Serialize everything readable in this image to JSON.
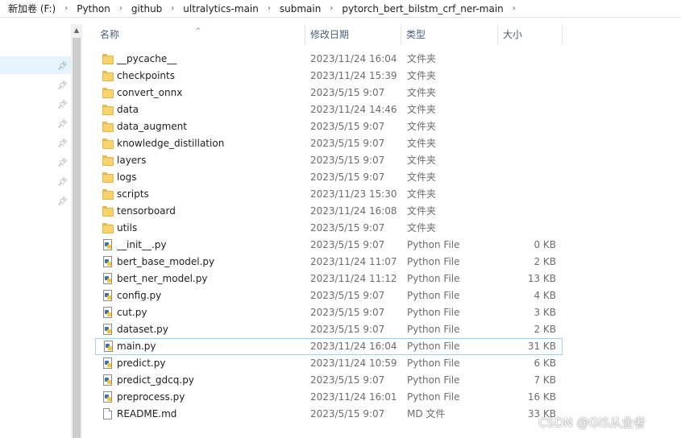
{
  "breadcrumb": [
    "新加卷 (F:)",
    "Python",
    "github",
    "ultralytics-main",
    "submain",
    "pytorch_bert_bilstm_crf_ner-main"
  ],
  "breadcrumb_separator": "›",
  "columns": {
    "name": "名称",
    "date": "修改日期",
    "type": "类型",
    "size": "大小",
    "sort_indicator": "^"
  },
  "files": [
    {
      "name": "__pycache__",
      "date": "2023/11/24 16:04",
      "type": "文件夹",
      "size": "",
      "icon": "folder-icon"
    },
    {
      "name": "checkpoints",
      "date": "2023/11/24 15:39",
      "type": "文件夹",
      "size": "",
      "icon": "folder-icon"
    },
    {
      "name": "convert_onnx",
      "date": "2023/5/15 9:07",
      "type": "文件夹",
      "size": "",
      "icon": "folder-icon"
    },
    {
      "name": "data",
      "date": "2023/11/24 14:46",
      "type": "文件夹",
      "size": "",
      "icon": "folder-icon"
    },
    {
      "name": "data_augment",
      "date": "2023/5/15 9:07",
      "type": "文件夹",
      "size": "",
      "icon": "folder-icon"
    },
    {
      "name": "knowledge_distillation",
      "date": "2023/5/15 9:07",
      "type": "文件夹",
      "size": "",
      "icon": "folder-icon"
    },
    {
      "name": "layers",
      "date": "2023/5/15 9:07",
      "type": "文件夹",
      "size": "",
      "icon": "folder-icon"
    },
    {
      "name": "logs",
      "date": "2023/5/15 9:07",
      "type": "文件夹",
      "size": "",
      "icon": "folder-icon"
    },
    {
      "name": "scripts",
      "date": "2023/11/23 15:30",
      "type": "文件夹",
      "size": "",
      "icon": "folder-icon"
    },
    {
      "name": "tensorboard",
      "date": "2023/11/24 16:08",
      "type": "文件夹",
      "size": "",
      "icon": "folder-icon"
    },
    {
      "name": "utils",
      "date": "2023/5/15 9:07",
      "type": "文件夹",
      "size": "",
      "icon": "folder-icon"
    },
    {
      "name": "__init__.py",
      "date": "2023/5/15 9:07",
      "type": "Python File",
      "size": "0 KB",
      "icon": "python-file-icon"
    },
    {
      "name": "bert_base_model.py",
      "date": "2023/11/24 11:07",
      "type": "Python File",
      "size": "2 KB",
      "icon": "python-file-icon"
    },
    {
      "name": "bert_ner_model.py",
      "date": "2023/11/24 11:12",
      "type": "Python File",
      "size": "13 KB",
      "icon": "python-file-icon"
    },
    {
      "name": "config.py",
      "date": "2023/5/15 9:07",
      "type": "Python File",
      "size": "4 KB",
      "icon": "python-file-icon"
    },
    {
      "name": "cut.py",
      "date": "2023/5/15 9:07",
      "type": "Python File",
      "size": "3 KB",
      "icon": "python-file-icon"
    },
    {
      "name": "dataset.py",
      "date": "2023/5/15 9:07",
      "type": "Python File",
      "size": "2 KB",
      "icon": "python-file-icon"
    },
    {
      "name": "main.py",
      "date": "2023/11/24 16:04",
      "type": "Python File",
      "size": "31 KB",
      "icon": "python-file-icon",
      "selected": true
    },
    {
      "name": "predict.py",
      "date": "2023/11/24 10:59",
      "type": "Python File",
      "size": "6 KB",
      "icon": "python-file-icon"
    },
    {
      "name": "predict_gdcq.py",
      "date": "2023/5/15 9:07",
      "type": "Python File",
      "size": "7 KB",
      "icon": "python-file-icon"
    },
    {
      "name": "preprocess.py",
      "date": "2023/11/24 16:01",
      "type": "Python File",
      "size": "16 KB",
      "icon": "python-file-icon"
    },
    {
      "name": "README.md",
      "date": "2023/5/15 9:07",
      "type": "MD 文件",
      "size": "33 KB",
      "icon": "document-icon"
    }
  ],
  "watermark": "CSDN @GIS从业者",
  "colors": {
    "selection_border": "#99d1ff",
    "nav_selected": "#e5f3fb",
    "folder": "#f8d26a",
    "header_text": "#4c607a"
  }
}
